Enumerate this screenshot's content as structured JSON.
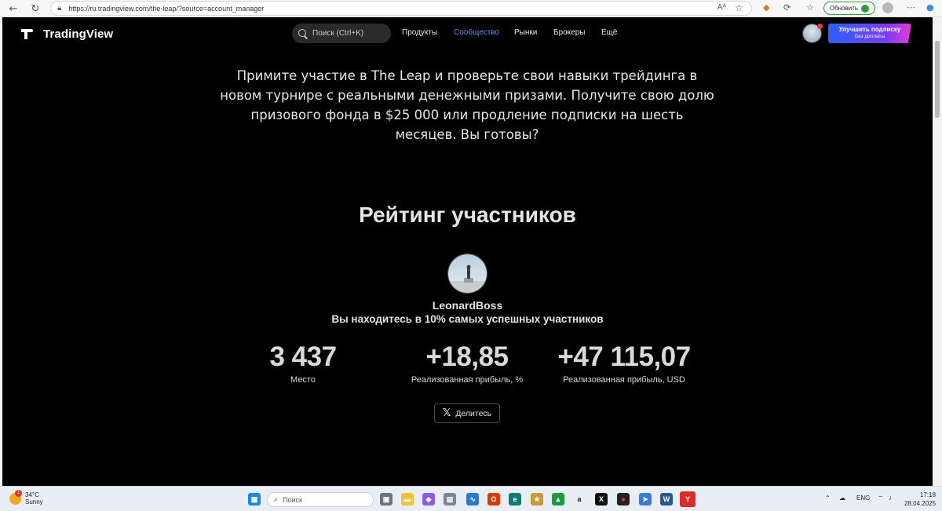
{
  "browser": {
    "url": "https://ru.tradingview.com/the-leap/?source=account_manager",
    "update_label": "Обновить"
  },
  "header": {
    "logo_text": "TradingView",
    "search_placeholder": "Поиск (Ctrl+K)",
    "menu": [
      {
        "label": "Продукты"
      },
      {
        "label": "Сообщество"
      },
      {
        "label": "Рынки"
      },
      {
        "label": "Брокеры"
      },
      {
        "label": "Ещё"
      }
    ],
    "upgrade": {
      "line1": "Улучшить подписку",
      "line2": "Без доплаты"
    }
  },
  "main": {
    "intro": "Примите участие в The Leap и проверьте свои навыки трейдинга в новом турнире с реальными денежными призами. Получите свою долю призового фонда в $25 000 или продление подписки на шесть месяцев. Вы готовы?",
    "rating_title": "Рейтинг участников",
    "username": "LeonardBoss",
    "subline": "Вы находитесь в 10% самых успешных участников",
    "stats": [
      {
        "value": "3 437",
        "label": "Место"
      },
      {
        "value": "+18,85",
        "label": "Реализованная прибыль, %"
      },
      {
        "value": "+47 115,07",
        "label": "Реализованная прибыль, USD"
      }
    ],
    "share_label": "Делитесь"
  },
  "taskbar": {
    "temperature": "34°C",
    "weather": "Sunny",
    "weather_badge": "1",
    "search_placeholder": "Поиск",
    "language": "ENG",
    "time": "17:18",
    "date": "28.04.2025"
  }
}
